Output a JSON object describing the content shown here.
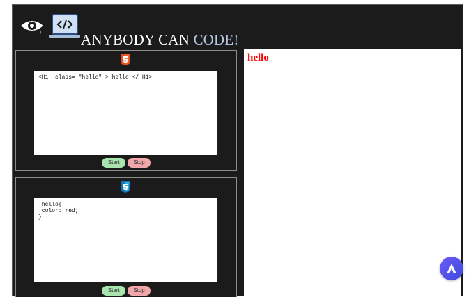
{
  "header": {
    "brand_main": "ANYBODY CAN ",
    "brand_accent": "CODE!"
  },
  "html_panel": {
    "badge_icon": "html5-icon",
    "code": "<H1  class= \"hello\" > hello </ H1>",
    "start_label": "Start",
    "stop_label": "Stop"
  },
  "css_panel": {
    "badge_icon": "css3-icon",
    "code": ".hello{\n color: red;\n}",
    "start_label": "Start",
    "stop_label": "Stop"
  },
  "preview": {
    "text": "hello",
    "text_color": "#ff0000"
  },
  "colors": {
    "background": "#1b1b1b",
    "start_button": "#a8e6ad",
    "stop_button": "#f2a8aa",
    "brand_accent": "#b7c8e6"
  }
}
